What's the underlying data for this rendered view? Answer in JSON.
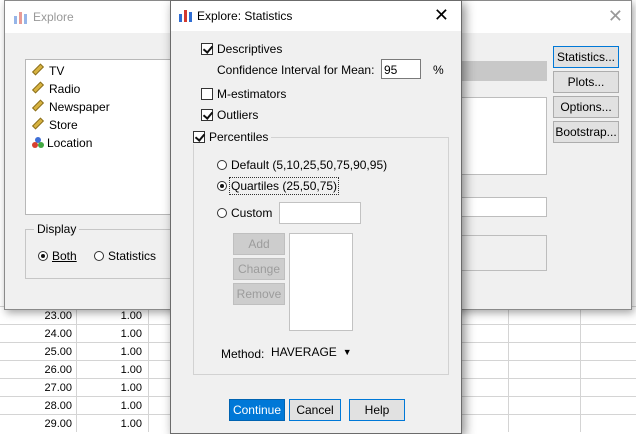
{
  "sheet": {
    "rows": [
      {
        "a": "23.00",
        "b": "1.00"
      },
      {
        "a": "24.00",
        "b": "1.00"
      },
      {
        "a": "25.00",
        "b": "1.00"
      },
      {
        "a": "26.00",
        "b": "1.00"
      },
      {
        "a": "27.00",
        "b": "1.00"
      },
      {
        "a": "28.00",
        "b": "1.00"
      },
      {
        "a": "29.00",
        "b": "1.00"
      }
    ]
  },
  "explore": {
    "title": "Explore",
    "variables": [
      {
        "label": "TV",
        "type": "scale"
      },
      {
        "label": "Radio",
        "type": "scale"
      },
      {
        "label": "Newspaper",
        "type": "scale"
      },
      {
        "label": "Store",
        "type": "scale"
      },
      {
        "label": "Location",
        "type": "nominal"
      }
    ],
    "buttons": {
      "statistics": "Statistics...",
      "plots": "Plots...",
      "options": "Options...",
      "bootstrap": "Bootstrap..."
    },
    "display": {
      "legend": "Display",
      "both": "Both",
      "statistics": "Statistics"
    }
  },
  "stats": {
    "title": "Explore: Statistics",
    "descriptives": "Descriptives",
    "ci_label": "Confidence Interval for Mean:",
    "ci_value": "95",
    "ci_unit": "%",
    "m_estimators": "M-estimators",
    "outliers": "Outliers",
    "percentiles": "Percentiles",
    "default": "Default (5,10,25,50,75,90,95)",
    "quartiles": "Quartiles (25,50,75)",
    "custom": "Custom",
    "add": "Add",
    "change": "Change",
    "remove": "Remove",
    "method_label": "Method:",
    "method_value": "HAVERAGE",
    "continue": "Continue",
    "cancel": "Cancel",
    "help": "Help"
  },
  "colors": {
    "accent": "#0078d7",
    "dialog_bg": "#f0f0f0"
  }
}
